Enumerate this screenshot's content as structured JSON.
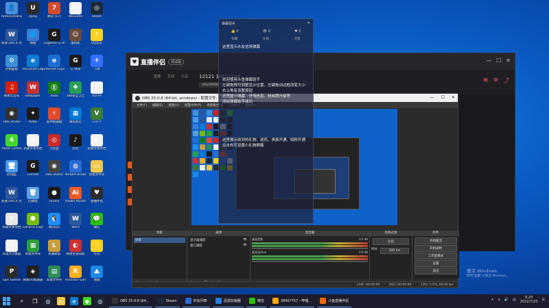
{
  "desktop_icons": [
    {
      "label": "Administrator",
      "color": "#4a90d9",
      "glyph": "👤"
    },
    {
      "label": "新建 DOCX 文档",
      "color": "#2b579a",
      "glyph": "W"
    },
    {
      "label": "控制面板",
      "color": "#3c8fd6",
      "glyph": "⚙"
    },
    {
      "label": "网易云音乐",
      "color": "#d81e06",
      "glyph": "♫"
    },
    {
      "label": "OBS Studio",
      "color": "#303030",
      "glyph": "◉"
    },
    {
      "label": "Razer Cortex",
      "color": "#44d62c",
      "glyph": "4"
    },
    {
      "label": "此电脑",
      "color": "#4c9be8",
      "glyph": "🖥"
    },
    {
      "label": "新建 DOCX 文档",
      "color": "#2b579a",
      "glyph": "W"
    },
    {
      "label": "新建文本文档",
      "color": "#e8e8e8",
      "glyph": "≡"
    },
    {
      "label": "风电大计算器",
      "color": "#f2f2f2",
      "glyph": "✈"
    },
    {
      "label": "Epic Games",
      "color": "#2b2b2b",
      "glyph": "P"
    },
    {
      "label": "Uplay",
      "color": "#2a2a2a",
      "glyph": "U"
    },
    {
      "label": "网络",
      "color": "#3b7bd6",
      "glyph": "🌐"
    },
    {
      "label": "Microsoft Edge",
      "color": "#0c7bd1",
      "glyph": "e"
    },
    {
      "label": "wallpaper",
      "color": "#c93030",
      "glyph": "W"
    },
    {
      "label": "PUBG",
      "color": "#1a1a1a",
      "glyph": "✦"
    },
    {
      "label": "新建文本文档",
      "color": "#f2f2f2",
      "glyph": "≡"
    },
    {
      "label": "LGHUB",
      "color": "#1a1a1a",
      "glyph": "G"
    },
    {
      "label": "回收站",
      "color": "#5a9fe0",
      "glyph": "🗑"
    },
    {
      "label": "GeForce Experience",
      "color": "#76b900",
      "glyph": "⬢"
    },
    {
      "label": "新建文件夹",
      "color": "#2c9e3a",
      "glyph": "▦"
    },
    {
      "label": "网易UU加速器",
      "color": "#1f1f1f",
      "glyph": "◈"
    },
    {
      "label": "腾讯 (17)",
      "color": "#d44a2c",
      "glyph": "7"
    },
    {
      "label": "Logitech G HUB",
      "color": "#1a1a1a",
      "glyph": "G"
    },
    {
      "label": "Internet Explorer",
      "color": "#1d6fd1",
      "glyph": "e"
    },
    {
      "label": "Xbox",
      "color": "#107c10",
      "glyph": "Ⓧ"
    },
    {
      "label": "雷神加速器",
      "color": "#e04a2b",
      "glyph": "⚡"
    },
    {
      "label": "小黑盒",
      "color": "#c92a2a",
      "glyph": "◎"
    },
    {
      "label": "OBS Studio",
      "color": "#444",
      "glyph": "◉"
    },
    {
      "label": "Oracle",
      "color": "#1a1a1a",
      "glyph": "●"
    },
    {
      "label": "腾讯QQ",
      "color": "#1e90ff",
      "glyph": "🐧"
    },
    {
      "label": "英雄联盟",
      "color": "#c89b3c",
      "glyph": "L"
    },
    {
      "label": "新建文件夹",
      "color": "#2e8b57",
      "glyph": "▤"
    },
    {
      "label": "WeGame",
      "color": "#f2f2f2",
      "glyph": "W"
    },
    {
      "label": "虚拟机",
      "color": "#6a4a3a",
      "glyph": "☺"
    },
    {
      "label": "G HUB",
      "color": "#1a1a1a",
      "glyph": "G"
    },
    {
      "label": "360安全卫士",
      "color": "#2a9d55",
      "glyph": "✚"
    },
    {
      "label": "微软商店",
      "color": "#0078d4",
      "glyph": "▦"
    },
    {
      "label": "抖音",
      "color": "#1a1a1a",
      "glyph": "♪"
    },
    {
      "label": "NVIDIA Broadcast",
      "color": "#2a6ad4",
      "glyph": "◍"
    },
    {
      "label": "Adobe Illustrator",
      "color": "#f25a22",
      "glyph": "Ai"
    },
    {
      "label": "Word",
      "color": "#2b579a",
      "glyph": "W"
    },
    {
      "label": "网易有道词典",
      "color": "#d03030",
      "glyph": "◐"
    },
    {
      "label": "Rockstar Games",
      "color": "#fcaf17",
      "glyph": "R"
    },
    {
      "label": "Steam",
      "color": "#1b2838",
      "glyph": "◎"
    },
    {
      "label": "QQ音乐",
      "color": "#ffd21e",
      "glyph": "♪"
    },
    {
      "label": "飞书",
      "color": "#3370ff",
      "glyph": "✈"
    },
    {
      "label": "iTunes",
      "color": "#f3f3f3",
      "glyph": "♫"
    },
    {
      "label": "GTA V",
      "color": "#3a7a3a",
      "glyph": "V"
    },
    {
      "label": "新建文本文档",
      "color": "#f2f2f2",
      "glyph": "≡"
    },
    {
      "label": "新建文件夹",
      "color": "#f2c94c",
      "glyph": "▭"
    },
    {
      "label": "直播伴侣",
      "color": "#2b2b2b",
      "glyph": "♥"
    },
    {
      "label": "微信",
      "color": "#2dc100",
      "glyph": "💬"
    },
    {
      "label": "夸克",
      "color": "#ffd21e",
      "glyph": "♡"
    },
    {
      "label": "地图",
      "color": "#1e88e5",
      "glyph": "⛰"
    }
  ],
  "live_app": {
    "title": "直播伴侣",
    "version": "测试版",
    "tabs": [
      "直播",
      "互动",
      "工具"
    ],
    "room_id": "12121 10511164",
    "game": "VALORANT",
    "controls": [
      "—",
      "☐",
      "✕"
    ]
  },
  "obs": {
    "title": "OBS 25.0.8 (64-bit, windows) - 配置文件: 未命名 - 场景: 未命名",
    "menu": [
      "文件(F)",
      "编辑(E)",
      "视图(V)",
      "配置文件(P)",
      "场景集合(S)",
      "工具(T)",
      "帮助(H)"
    ],
    "docks": {
      "scenes": {
        "title": "场景",
        "items": [
          "场景"
        ]
      },
      "sources": {
        "title": "来源",
        "items": [
          "显示器捕获",
          "窗口捕获"
        ]
      },
      "mixer": {
        "title": "混音器",
        "channels": [
          {
            "name": "桌面音频",
            "level": "0.0 dB"
          },
          {
            "name": "麦克风/Aux",
            "level": "0.0 dB"
          }
        ]
      },
      "transitions": {
        "title": "场景过渡",
        "type": "淡出",
        "duration_label": "时长",
        "duration": "300 ms"
      },
      "controls": {
        "title": "控件",
        "buttons": [
          "开始推流",
          "开始录制",
          "工作室模式",
          "设置",
          "退出"
        ]
      }
    },
    "status": [
      "LIVE: 00:00:00",
      "REC: 00:00:00",
      "CPU: 1.5%, 60.00 fps"
    ]
  },
  "overlay": {
    "title": "弹幕助手",
    "stats": [
      "👍 0",
      "👁 0",
      "♥ 0"
    ],
    "tabs": [
      "弹幕",
      "礼物",
      "点赞"
    ],
    "messages_top": [
      "这里显示水友进场弹幕"
    ],
    "messages_mid": [
      "欢迎使用斗鱼弹幕助手",
      "左键拖拽可调整显示位置，左键拖动边框改变大小",
      "右上角有设置按钮",
      "这里提示弹幕、进场信息、粉丝牌升级等",
      "添加弹幕助手成功"
    ],
    "messages_bottom": [
      "这里展示收到的礼物、送药、贵族开通、知粉开通",
      "点击右可设置小礼物屏蔽"
    ]
  },
  "taskbar": {
    "apps": [
      {
        "label": "OBS 25.0.8 (64...",
        "color": "#333"
      },
      {
        "label": "Steam",
        "color": "#1b2838"
      },
      {
        "label": "好友列表",
        "color": "#2a6ad4"
      },
      {
        "label": "迅雷加速器",
        "color": "#2b7de0"
      },
      {
        "label": "微信",
        "color": "#2dc100"
      },
      {
        "label": "39907757 - 哔哩...",
        "color": "#f2a600"
      },
      {
        "label": "斗鱼直播伴侣",
        "color": "#ff6a00"
      }
    ],
    "time": "0:23",
    "date": "2022/7/20"
  },
  "watermark": {
    "line1": "激活 Windows",
    "line2": "转到\"设置\"以激活 Windows。"
  }
}
